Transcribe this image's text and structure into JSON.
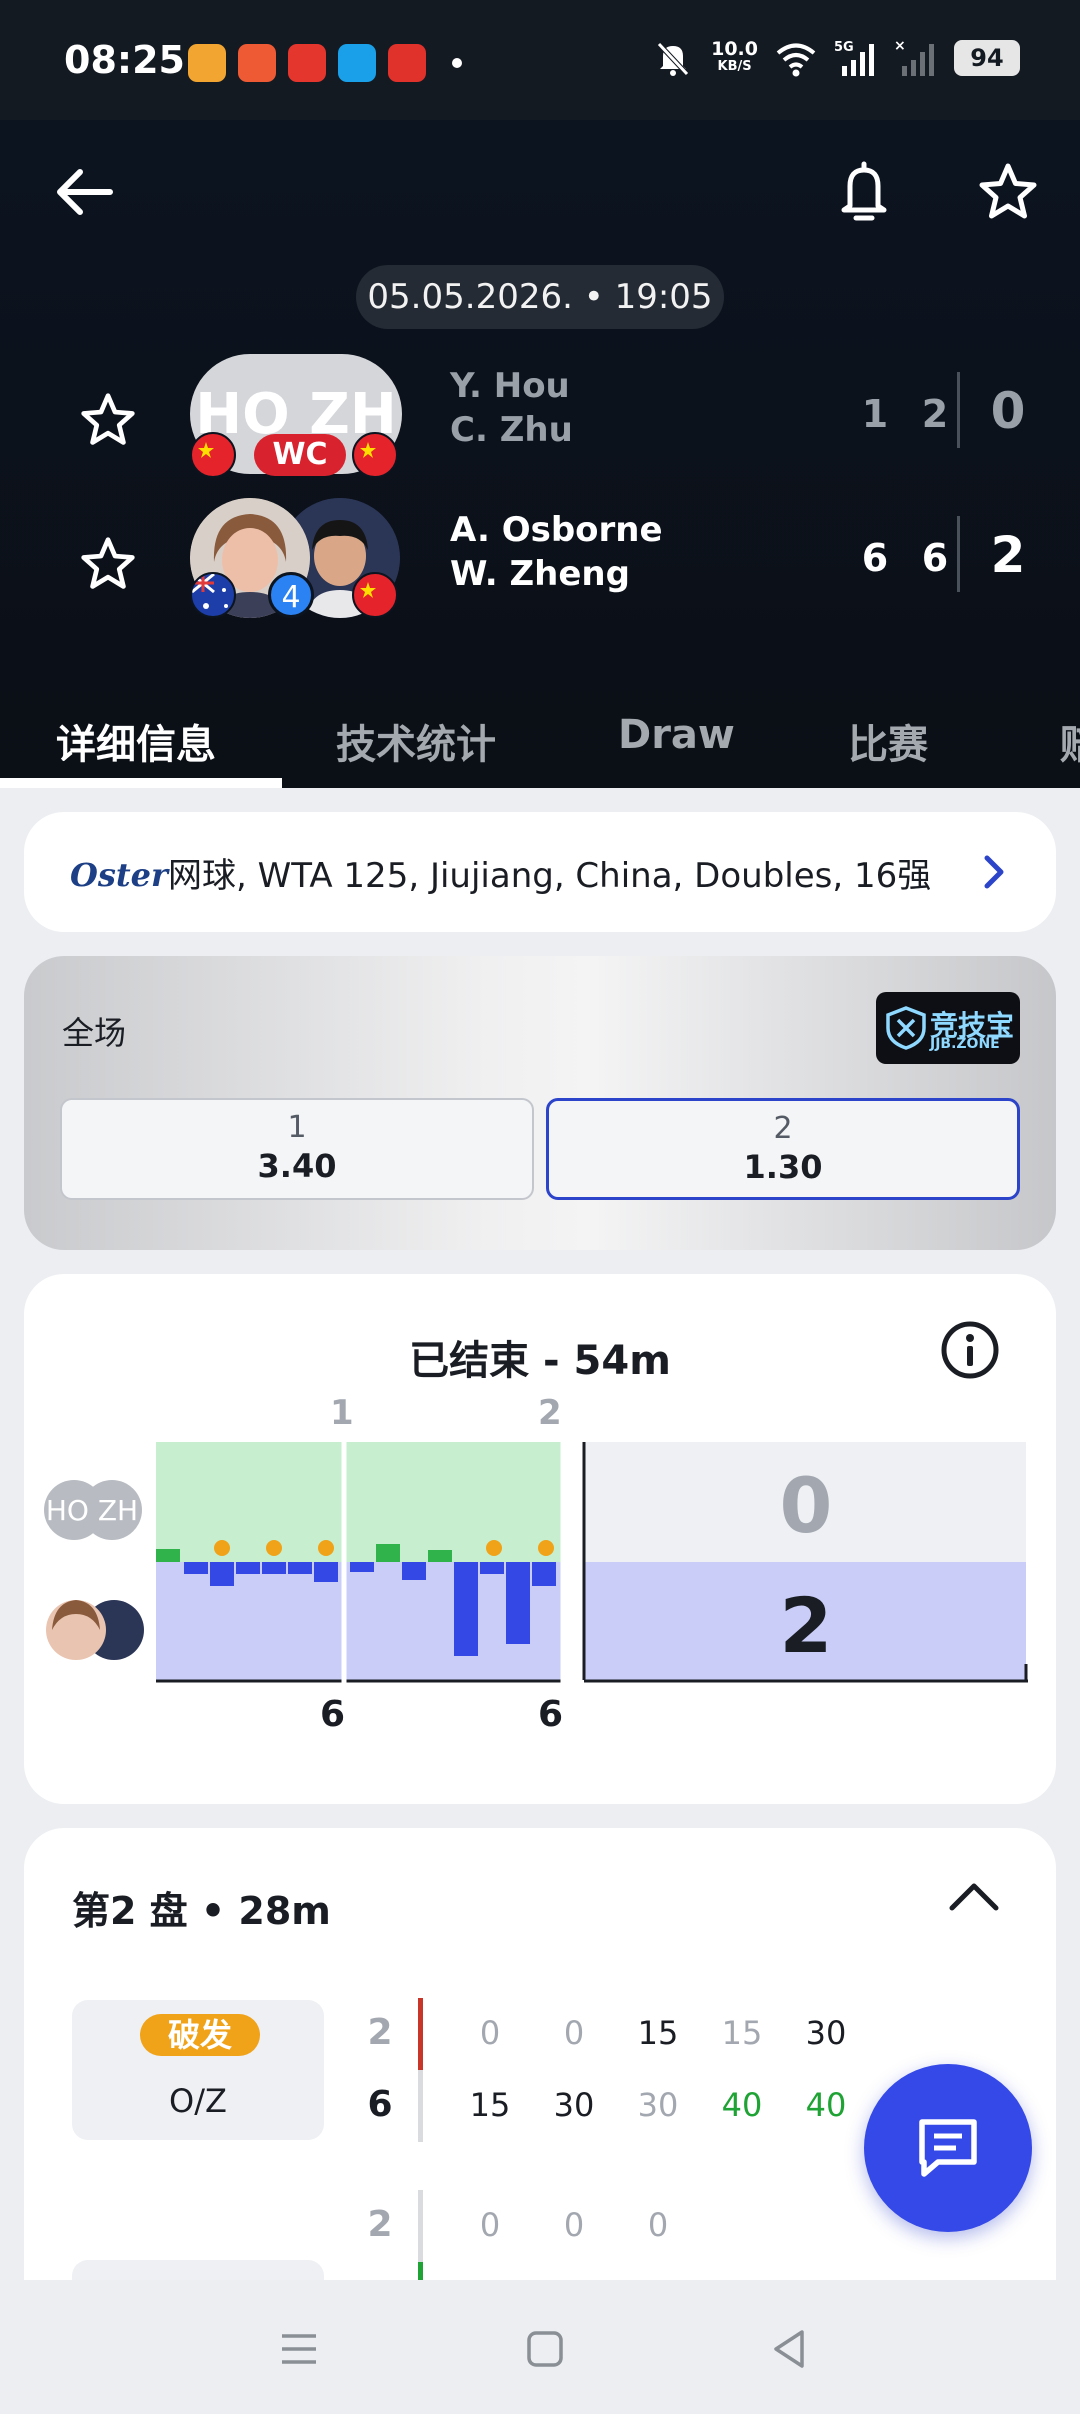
{
  "status_bar": {
    "time": "08:25",
    "net_speed_value": "10.0",
    "net_speed_unit": "KB/S",
    "network": "5G",
    "battery": "94",
    "app_icon_colors": [
      "#f2a531",
      "#ee5a33",
      "#e5362e",
      "#1aa0e8",
      "#e0312b"
    ]
  },
  "header": {
    "date_time": "05.05.2026. • 19:05",
    "team1": {
      "player1": "Y. Hou",
      "player2": "C. Zhu",
      "avatar_initials": "HO ZH",
      "badge": "WC",
      "set_scores": [
        "1",
        "2"
      ],
      "total": "0"
    },
    "team2": {
      "player1": "A. Osborne",
      "player2": "W. Zheng",
      "seed": "4",
      "set_scores": [
        "6",
        "6"
      ],
      "total": "2"
    }
  },
  "tabs": [
    "详细信息",
    "技术统计",
    "Draw",
    "比赛",
    "赔"
  ],
  "league": {
    "sponsor": "Oster",
    "text": "网球, WTA 125, Jiujiang, China, Doubles, 16强"
  },
  "odds": {
    "title": "全场",
    "bookmaker": "竞技宝",
    "bookmaker_sub": "JJB.ZONE",
    "options": [
      {
        "label": "1",
        "value": "3.40"
      },
      {
        "label": "2",
        "value": "1.30"
      }
    ],
    "selected_index": 1
  },
  "momentum": {
    "title": "已结束 - 54m",
    "team1_initials": "HO ZH",
    "set_markers": [
      "1",
      "2"
    ],
    "set_games": [
      "6",
      "6"
    ],
    "score_team1": "0",
    "score_team2": "2",
    "colors": {
      "team1": "#2fb34a",
      "team2": "#3448e6",
      "team1_bg": "#c7efcf",
      "team2_bg": "#c9cdf8",
      "break": "#f0a219"
    }
  },
  "set_detail": {
    "title": "第2 盘 • 28m",
    "game1": {
      "badge": "破发",
      "server": "O/Z",
      "games_top": "2",
      "games_bottom": "6",
      "points_top": [
        "0",
        "0",
        "15",
        "15",
        "30"
      ],
      "points_bottom": [
        "15",
        "30",
        "30",
        "40",
        "40"
      ]
    },
    "game2": {
      "games_top": "2",
      "points_top": [
        "0",
        "0",
        "0"
      ]
    }
  },
  "colors": {
    "accent": "#3549e8",
    "header_bg": "#0c1420",
    "green": "#1fa334",
    "break_orange": "#f0a219"
  }
}
